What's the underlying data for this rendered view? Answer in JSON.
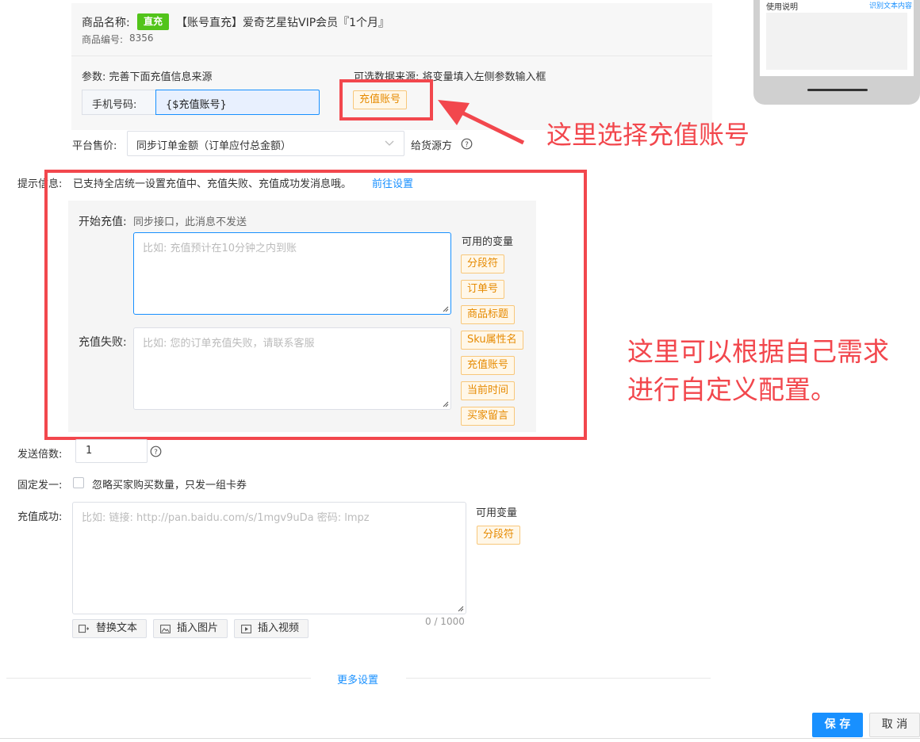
{
  "product": {
    "name_label": "商品名称:",
    "badge": "直充",
    "name_value": "【账号直充】爱奇艺星钻VIP会员『1个月』",
    "code_label": "商品编号:",
    "code_value": "8356"
  },
  "params": {
    "label": "参数: 完善下面充值信息来源",
    "source_label": "可选数据来源: 将变量填入左侧参数输入框",
    "phone_label": "手机号码:",
    "phone_value": "{$充值账号}",
    "source_tag": "充值账号"
  },
  "platform": {
    "label": "平台售价:",
    "select_value": "同步订单金额（订单应付总金额）",
    "supply_label": "给货源方"
  },
  "tip": {
    "label": "提示信息:",
    "text": "已支持全店统一设置充值中、充值失败、充值成功发消息哦。",
    "link": "前往设置"
  },
  "messages": {
    "start_label": "开始充值:",
    "start_note": "同步接口，此消息不发送",
    "start_placeholder": "比如: 充值预计在10分钟之内到账",
    "fail_label": "充值失败:",
    "fail_placeholder": "比如: 您的订单充值失败，请联系客服",
    "vars_title": "可用的变量",
    "vars": [
      "分段符",
      "订单号",
      "商品标题",
      "Sku属性名",
      "充值账号",
      "当前时间",
      "买家留言"
    ]
  },
  "send": {
    "multiple_label": "发送倍数:",
    "multiple_value": "1",
    "fixed_label": "固定发一:",
    "fixed_text": "忽略买家购买数量，只发一组卡券"
  },
  "success": {
    "label": "充值成功:",
    "placeholder": "比如: 链接: http://pan.baidu.com/s/1mgv9uDa 密码: lmpz",
    "vars_title": "可用变量",
    "var": "分段符",
    "counter": "0 / 1000",
    "btn_replace": "替换文本",
    "btn_image": "插入图片",
    "btn_video": "插入视频"
  },
  "more": "更多设置",
  "footer": {
    "save": "保 存",
    "cancel": "取 消"
  },
  "phone_preview": {
    "title": "使用说明",
    "link": "识别文本内容"
  },
  "annotations": {
    "select_account": "这里选择充值账号",
    "custom_line1": "这里可以根据自己需求",
    "custom_line2": "进行自定义配置。"
  },
  "colors": {
    "accent": "#1890ff",
    "annotation": "#f2474d",
    "tag_border": "#f8c77a",
    "badge": "#52c41a"
  }
}
